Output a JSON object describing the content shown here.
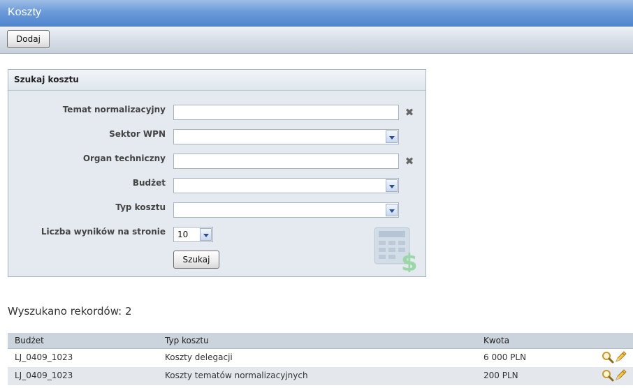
{
  "window": {
    "title": "Koszty"
  },
  "toolbar": {
    "add_label": "Dodaj"
  },
  "search_panel": {
    "title": "Szukaj kosztu",
    "fields": {
      "topic": {
        "label": "Temat normalizacyjny",
        "value": ""
      },
      "sector": {
        "label": "Sektor WPN",
        "value": ""
      },
      "tech_body": {
        "label": "Organ techniczny",
        "value": ""
      },
      "budget": {
        "label": "Budżet",
        "value": ""
      },
      "cost_type": {
        "label": "Typ kosztu",
        "value": ""
      },
      "per_page": {
        "label": "Liczba wyników na stronie",
        "value": "10"
      }
    },
    "search_label": "Szukaj",
    "decor_icon": "calculator-dollar-icon"
  },
  "results": {
    "count_text": "Wyszukano rekordów: 2",
    "columns": [
      "Budżet",
      "Typ kosztu",
      "Kwota"
    ],
    "rows": [
      {
        "budget": "LJ_0409_1023",
        "cost_type": "Koszty delegacji",
        "amount": "6 000 PLN"
      },
      {
        "budget": "LJ_0409_1023",
        "cost_type": "Koszty tematów normalizacyjnych",
        "amount": "200 PLN"
      }
    ],
    "row_actions": [
      "magnifier-icon",
      "pencil-icon"
    ]
  },
  "colors": {
    "title_bar": "#5b8fd4",
    "panel_bg": "#e4eaf0",
    "header_row": "#cbd3dc",
    "alt_row": "#e4e8ec"
  }
}
